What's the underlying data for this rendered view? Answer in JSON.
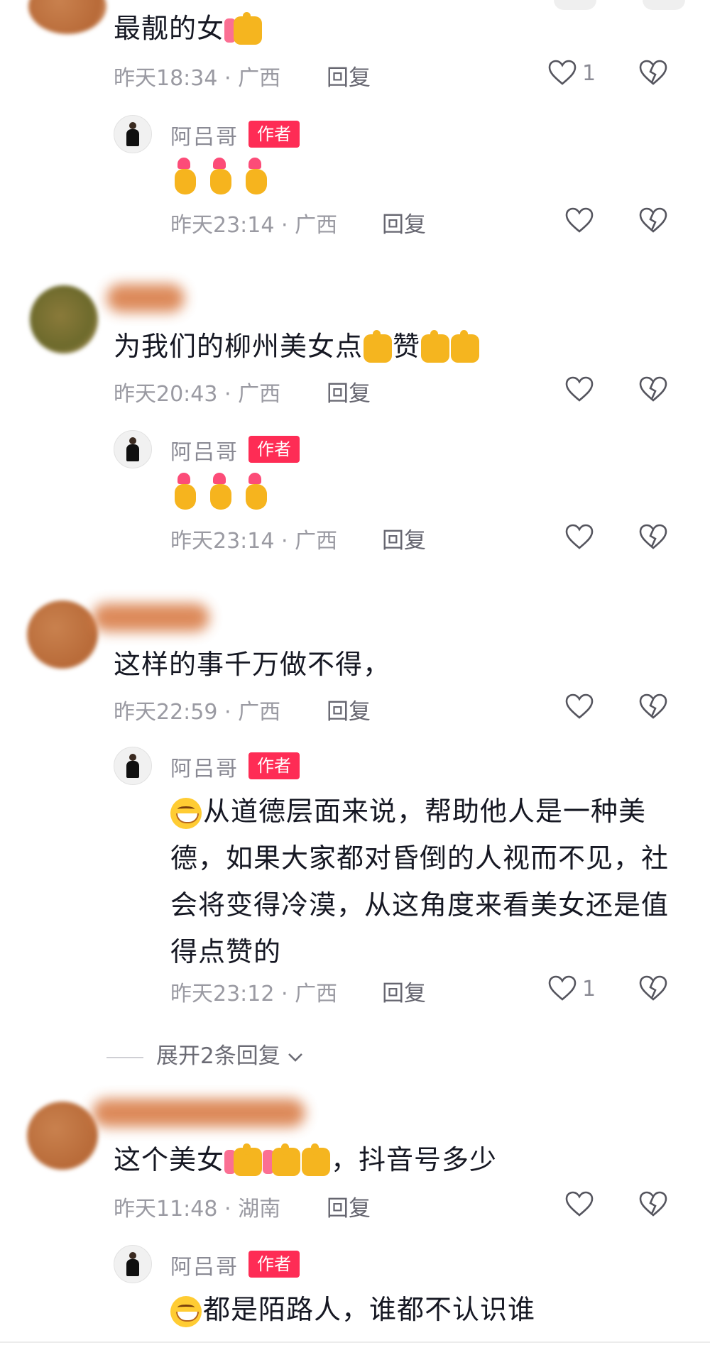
{
  "comments": [
    {
      "text": "最靓的女",
      "time": "昨天18:34",
      "location": "广西",
      "reply_label": "回复",
      "likes": "1",
      "author_reply": {
        "author": "阿吕哥",
        "badge": "作者",
        "text": "",
        "time": "昨天23:14",
        "location": "广西",
        "reply_label": "回复",
        "likes": ""
      }
    },
    {
      "text": "为我们的柳州美女点",
      "text_after": "赞",
      "time": "昨天20:43",
      "location": "广西",
      "reply_label": "回复",
      "likes": "",
      "author_reply": {
        "author": "阿吕哥",
        "badge": "作者",
        "text": "",
        "time": "昨天23:14",
        "location": "广西",
        "reply_label": "回复",
        "likes": ""
      }
    },
    {
      "text": "这样的事千万做不得，",
      "time": "昨天22:59",
      "location": "广西",
      "reply_label": "回复",
      "likes": "",
      "author_reply": {
        "author": "阿吕哥",
        "badge": "作者",
        "text": "从道德层面来说，帮助他人是一种美德，如果大家都对昏倒的人视而不见，社会将变得冷漠，从这角度来看美女还是值得点赞的",
        "time": "昨天23:12",
        "location": "广西",
        "reply_label": "回复",
        "likes": "1"
      },
      "expand_label": "展开2条回复"
    },
    {
      "text": "这个美女",
      "text_after": "，抖音号多少",
      "time": "昨天11:48",
      "location": "湖南",
      "reply_label": "回复",
      "likes": "",
      "author_reply": {
        "author": "阿吕哥",
        "badge": "作者",
        "text": "都是陌路人，谁都不认识谁",
        "time": "",
        "location": "",
        "reply_label": "",
        "likes": ""
      }
    }
  ],
  "meta_separator": "·",
  "icons": {
    "like": "heart-outline-icon",
    "dislike": "broken-heart-icon",
    "expand": "chevron-down-icon"
  },
  "colors": {
    "badge": "#fe2c55",
    "meta": "#9a9aa2",
    "text": "#161823"
  }
}
